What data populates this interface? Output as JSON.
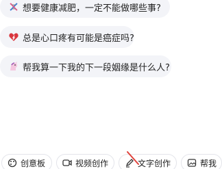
{
  "suggestions": [
    {
      "emoji": "dna-icon",
      "text": "想要健康减肥，一定不能做哪些事?"
    },
    {
      "emoji": "heart-icon",
      "text": "总是心口疼有可能是癌症吗?"
    },
    {
      "emoji": "unicorn-icon",
      "text": "帮我算一下我的下一段姻缘是什么人?"
    }
  ],
  "toolbar": {
    "items": [
      {
        "icon": "palette-icon",
        "label": "创意板"
      },
      {
        "icon": "video-icon",
        "label": "视频创作"
      },
      {
        "icon": "pen-icon",
        "label": "文字创作"
      },
      {
        "icon": "image-icon",
        "label": "帮我"
      }
    ]
  },
  "colors": {
    "chip_bg": "#f3f4f8",
    "tool_border": "#e3e4ea",
    "text": "#222222",
    "accent_red": "#e0413a"
  }
}
